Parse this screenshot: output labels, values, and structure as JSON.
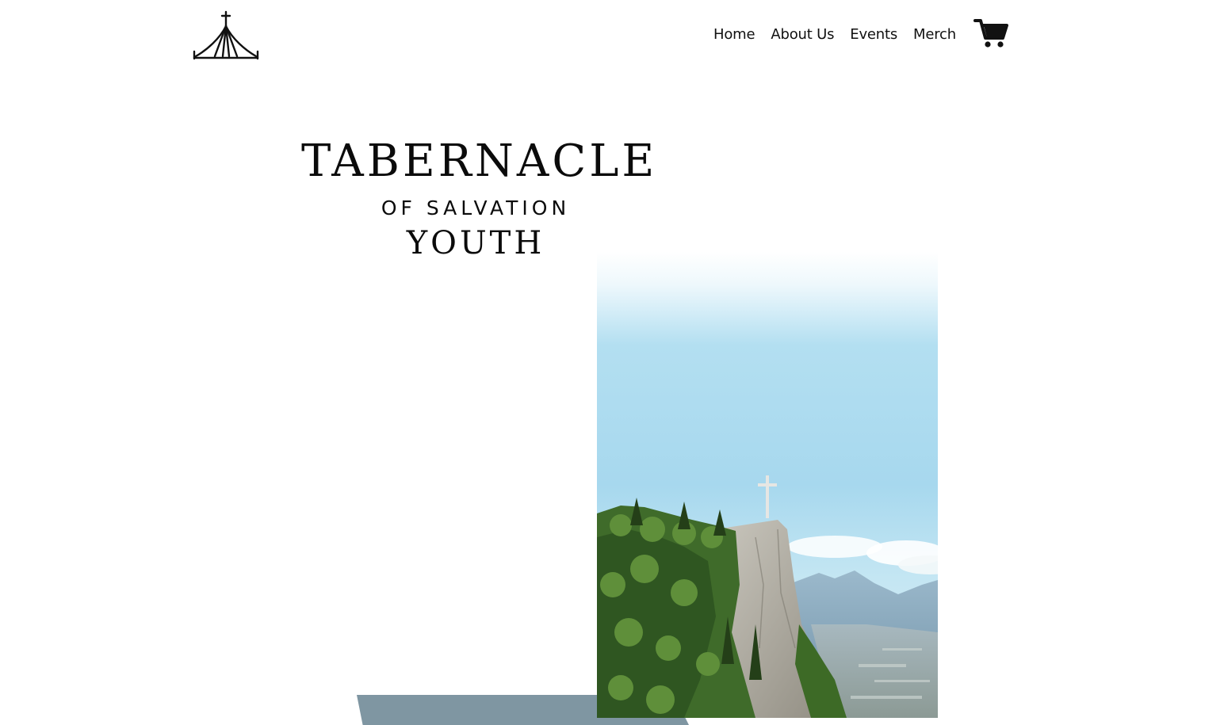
{
  "header": {
    "logo_icon": "tent-cross-icon",
    "nav": [
      {
        "label": "Home"
      },
      {
        "label": "About Us"
      },
      {
        "label": "Events"
      },
      {
        "label": "Merch"
      }
    ],
    "cart_icon": "shopping-cart-icon"
  },
  "hero": {
    "title_line1": "TABERNACLE",
    "title_line2": "OF SALVATION",
    "title_line3": "YOUTH",
    "image_icon": "cross-on-mountain-photo"
  },
  "colors": {
    "slate": "#7f96a2",
    "sky": "#a9d9ee",
    "text": "#0b0b0b"
  }
}
